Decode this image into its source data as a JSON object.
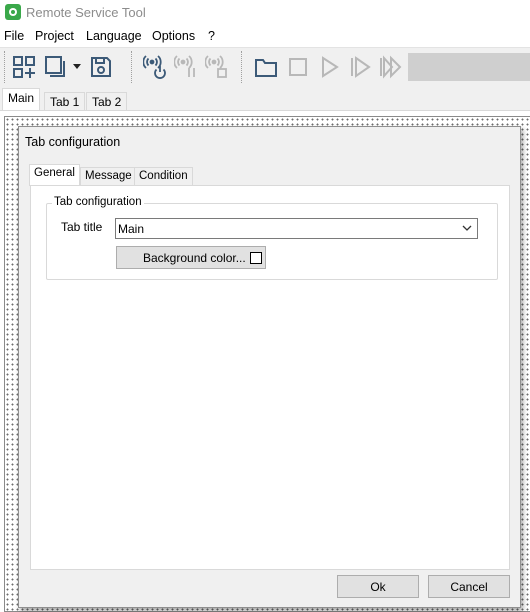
{
  "window": {
    "title": "Remote Service Tool",
    "icon": "app-logo-icon"
  },
  "menu": [
    "File",
    "Project",
    "Language",
    "Options",
    "?"
  ],
  "toolbar": {
    "icons": [
      "add-grid-icon",
      "window-dropdown-icon",
      "save-disk-icon",
      "connect-power-icon",
      "pause-signal-icon",
      "stop-signal-icon",
      "folder-icon",
      "stop-icon",
      "play-icon",
      "step-icon",
      "fast-forward-icon"
    ],
    "progress_color": "#cfcfcf"
  },
  "main_tabs": [
    "Main",
    "Tab 1",
    "Tab 2"
  ],
  "dialog": {
    "title": "Tab configuration",
    "tabs": [
      "General",
      "Message",
      "Condition"
    ],
    "group_label": "Tab configuration",
    "tab_title_label": "Tab title",
    "tab_title_value": "Main",
    "background_button": "Background color...",
    "background_swatch": "#ffffff",
    "ok_label": "Ok",
    "cancel_label": "Cancel"
  },
  "colors": {
    "accent": "#3aa84a",
    "icon_blue": "#3c5a78",
    "icon_disabled": "#b8b8b8"
  }
}
